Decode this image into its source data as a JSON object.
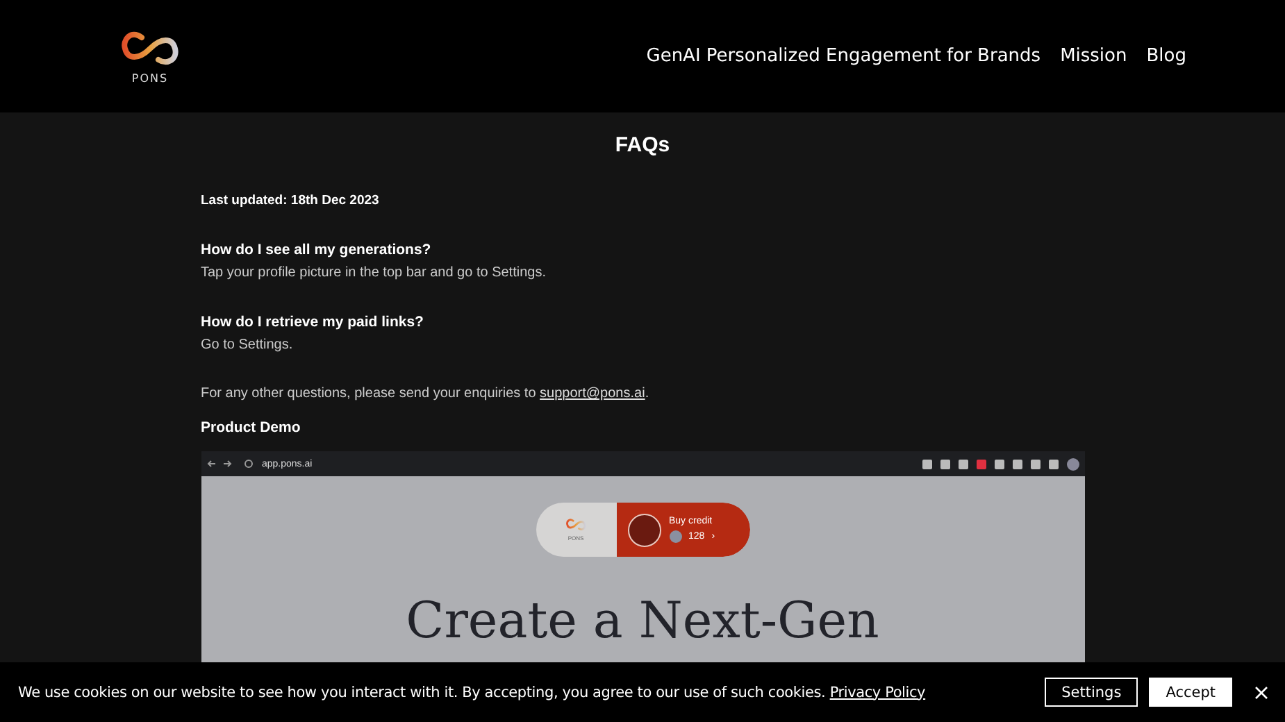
{
  "header": {
    "logo_text": "PONS",
    "nav": [
      {
        "label": "GenAI Personalized Engagement for Brands"
      },
      {
        "label": "Mission"
      },
      {
        "label": "Blog"
      }
    ]
  },
  "page": {
    "title": "FAQs",
    "updated": "Last updated: 18th Dec 2023",
    "faqs": [
      {
        "question": "How do I see all my generations?",
        "answer": "Tap your profile picture in the top bar and go to Settings."
      },
      {
        "question": "How do I retrieve my paid links?",
        "answer": "Go to Settings."
      }
    ],
    "contact": {
      "text": "For any other questions, please send your enquiries to ",
      "link": "support@pons.ai",
      "end": "."
    },
    "demo_title": "Product Demo",
    "demo": {
      "url": "app.pons.ai",
      "logo_text": "PONS",
      "buy_label": "Buy credit",
      "credits": "128",
      "chevron": "›",
      "headline": "Create a Next-Gen"
    }
  },
  "cookie": {
    "text": "We use cookies on our website to see how you interact with it. By accepting, you agree to our use of such cookies.",
    "link": "Privacy Policy",
    "buttons": [
      {
        "label": "Settings",
        "kind": "outline"
      },
      {
        "label": "Accept",
        "kind": "filled"
      }
    ]
  }
}
